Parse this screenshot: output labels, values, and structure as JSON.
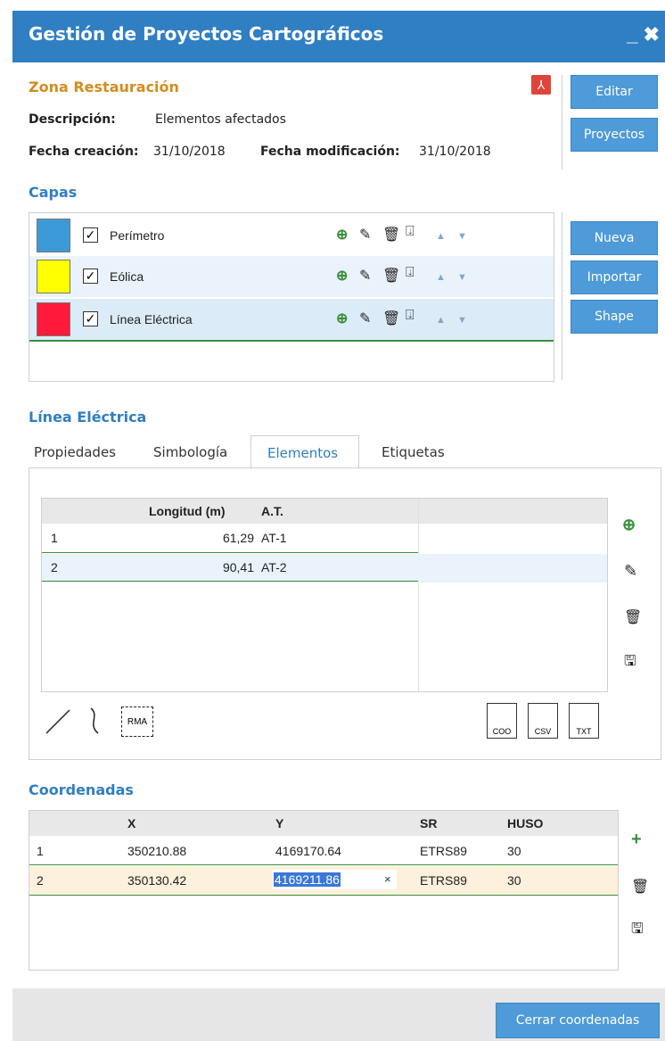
{
  "window": {
    "title": "Gestión de Proyectos Cartográficos",
    "controls": "_ ✖"
  },
  "project": {
    "name": "Zona Restauración",
    "description_label": "Descripción:",
    "description_value": "Elementos afectados",
    "created_label": "Fecha creación:",
    "created_value": "31/10/2018",
    "modified_label": "Fecha modificación:",
    "modified_value": "31/10/2018"
  },
  "buttons": {
    "edit": "Editar",
    "projects": "Proyectos",
    "new": "Nueva",
    "import": "Importar",
    "shape": "Shape",
    "close_coords": "Cerrar coordenadas"
  },
  "layers": {
    "title": "Capas",
    "items": [
      {
        "name": "Perímetro",
        "color": "#3c9ad6",
        "checked": "✓"
      },
      {
        "name": "Eólica",
        "color": "#ffff00",
        "checked": "✓"
      },
      {
        "name": "Línea Eléctrica",
        "color": "#ff1a3c",
        "checked": "✓"
      }
    ]
  },
  "selected_layer": {
    "title": "Línea Eléctrica",
    "tabs": [
      "Propiedades",
      "Simbología",
      "Elementos",
      "Etiquetas"
    ],
    "active_tab": "Elementos",
    "columns": [
      "Longitud (m)",
      "A.T."
    ],
    "rows": [
      {
        "id": "1",
        "length": "61,29",
        "at": "AT-1"
      },
      {
        "id": "2",
        "length": "90,41",
        "at": "AT-2"
      }
    ],
    "export_formats": [
      "COO",
      "CSV",
      "TXT"
    ],
    "rma_label": "RMA"
  },
  "coordinates": {
    "title": "Coordenadas",
    "columns": [
      "X",
      "Y",
      "SR",
      "HUSO"
    ],
    "rows": [
      {
        "id": "1",
        "x": "350210.88",
        "y": "4169170.64",
        "sr": "ETRS89",
        "huso": "30"
      },
      {
        "id": "2",
        "x": "350130.42",
        "y": "4169211.86",
        "sr": "ETRS89",
        "huso": "30"
      }
    ],
    "clear_symbol": "×"
  },
  "colors": {
    "accent": "#2f7fc2",
    "button": "#4f9ad8",
    "selected_text": "#d38d1c",
    "selected_row": "#fdf0dc",
    "add_green": "#3a8f3a"
  }
}
